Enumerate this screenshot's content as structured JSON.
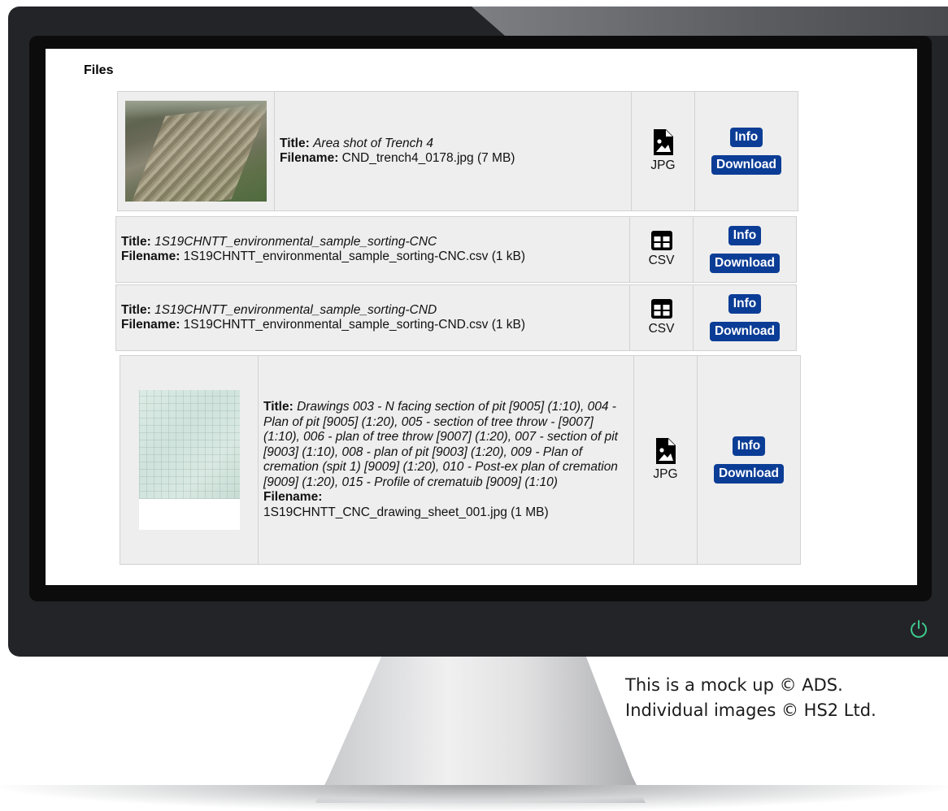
{
  "page": {
    "heading": "Files"
  },
  "files": [
    {
      "title_label": "Title:",
      "title": "Area shot of Trench 4",
      "filename_label": "Filename:",
      "filename": "CND_trench4_0178.jpg (7 MB)",
      "type": "JPG",
      "type_icon": "image-file-icon",
      "info_label": "Info",
      "download_label": "Download"
    },
    {
      "title_label": "Title:",
      "title": "1S19CHNTT_environmental_sample_sorting-CNC",
      "filename_label": "Filename:",
      "filename": "1S19CHNTT_environmental_sample_sorting-CNC.csv (1 kB)",
      "type": "CSV",
      "type_icon": "table-icon",
      "info_label": "Info",
      "download_label": "Download"
    },
    {
      "title_label": "Title:",
      "title": "1S19CHNTT_environmental_sample_sorting-CND",
      "filename_label": "Filename:",
      "filename": "1S19CHNTT_environmental_sample_sorting-CND.csv (1 kB)",
      "type": "CSV",
      "type_icon": "table-icon",
      "info_label": "Info",
      "download_label": "Download"
    },
    {
      "title_label": "Title:",
      "title": "Drawings 003 - N facing section of pit [9005] (1:10), 004 - Plan of pit [9005] (1:20), 005 - section of tree throw - [9007] (1:10), 006 - plan of tree throw [9007] (1:20), 007 - section of pit [9003] (1:10), 008 - plan of pit [9003] (1:20), 009 - Plan of cremation (spit 1) [9009] (1:20), 010 - Post-ex plan of cremation [9009] (1:20), 015 - Profile of crematuib [9009] (1:10)",
      "filename_label": "Filename:",
      "filename": "1S19CHNTT_CNC_drawing_sheet_001.jpg (1 MB)",
      "type": "JPG",
      "type_icon": "image-file-icon",
      "info_label": "Info",
      "download_label": "Download"
    }
  ],
  "caption": {
    "line1": "This is a mock up © ADS.",
    "line2": "Individual images © HS2 Ltd."
  },
  "colors": {
    "button_bg": "#0b3d96",
    "row_bg": "#eeeeee",
    "power_icon": "#3ec98e"
  }
}
